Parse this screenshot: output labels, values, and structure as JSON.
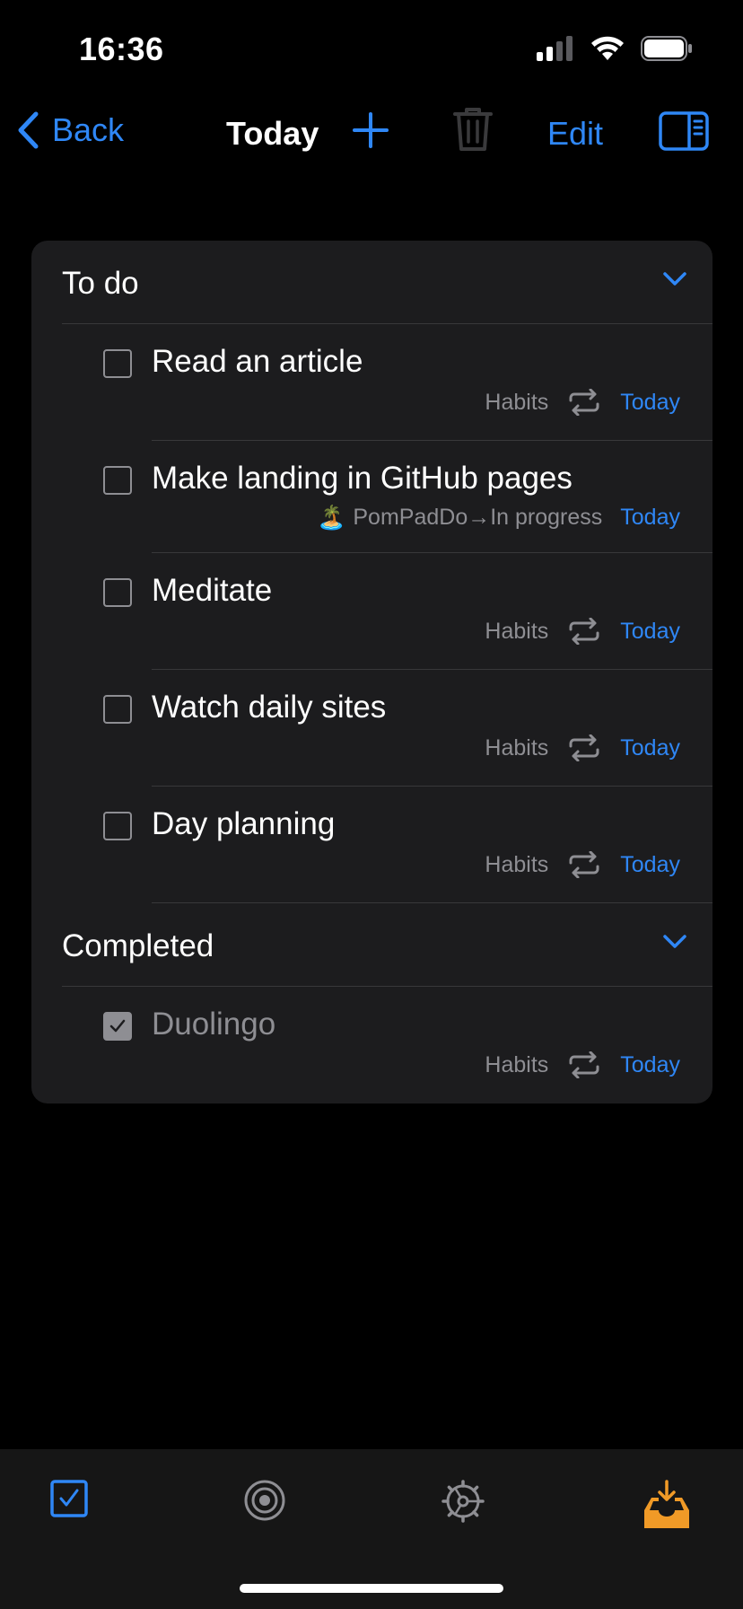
{
  "status": {
    "time": "16:36"
  },
  "nav": {
    "back_label": "Back",
    "title": "Today",
    "edit_label": "Edit"
  },
  "sections": {
    "todo": {
      "title": "To do"
    },
    "completed": {
      "title": "Completed"
    }
  },
  "tasks": [
    {
      "title": "Read an article",
      "list": "Habits",
      "repeat": true,
      "date": "Today"
    },
    {
      "title": "Make landing in GitHub pages",
      "emoji": "🏝️",
      "list": "PomPadDo→In progress",
      "repeat": false,
      "date": "Today"
    },
    {
      "title": "Meditate",
      "list": "Habits",
      "repeat": true,
      "date": "Today"
    },
    {
      "title": "Watch daily sites",
      "list": "Habits",
      "repeat": true,
      "date": "Today"
    },
    {
      "title": "Day planning",
      "list": "Habits",
      "repeat": true,
      "date": "Today"
    }
  ],
  "completed_tasks": [
    {
      "title": "Duolingo",
      "list": "Habits",
      "repeat": true,
      "date": "Today",
      "checked": true
    }
  ],
  "tabs": [
    {
      "icon": "checkbox-icon",
      "active": true
    },
    {
      "icon": "target-icon",
      "active": false
    },
    {
      "icon": "gear-icon",
      "active": false
    },
    {
      "icon": "inbox-icon",
      "active": false
    }
  ],
  "colors": {
    "accent": "#2f87f6",
    "inbox": "#f09a27",
    "card": "#1c1c1e",
    "secondary": "#8e8e93"
  }
}
